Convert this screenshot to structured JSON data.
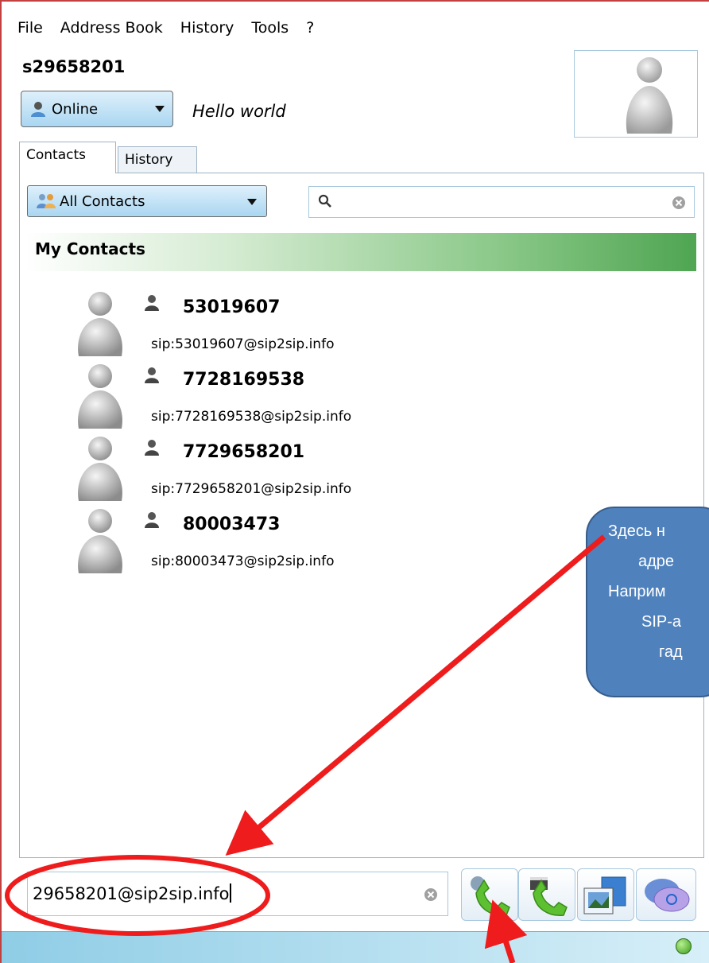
{
  "menu": {
    "items": [
      "File",
      "Address Book",
      "History",
      "Tools",
      "?"
    ]
  },
  "account": {
    "username": "s29658201",
    "status": "Online",
    "mood": "Hello world"
  },
  "tabs": {
    "contacts": "Contacts",
    "history": "History"
  },
  "filter": {
    "group": "All Contacts",
    "search_value": ""
  },
  "group_header": "My Contacts",
  "contacts": [
    {
      "name": "53019607",
      "sip": "sip:53019607@sip2sip.info"
    },
    {
      "name": "7728169538",
      "sip": "sip:7728169538@sip2sip.info"
    },
    {
      "name": "7729658201",
      "sip": "sip:7729658201@sip2sip.info"
    },
    {
      "name": "80003473",
      "sip": "sip:80003473@sip2sip.info"
    }
  ],
  "callout": {
    "lines": [
      "Здесь н",
      "адре",
      "Наприм",
      "SIP-а",
      "гад"
    ]
  },
  "address_input": {
    "value": "29658201@sip2sip.info"
  },
  "actions": {
    "icons": [
      "voice-call-icon",
      "video-call-icon",
      "file-transfer-icon",
      "chat-icon"
    ]
  },
  "colors": {
    "callout_fill": "#4f81bd",
    "annotation_red": "#ee1c1c",
    "header_green": "#4fa552",
    "call_green": "#5cc031"
  }
}
